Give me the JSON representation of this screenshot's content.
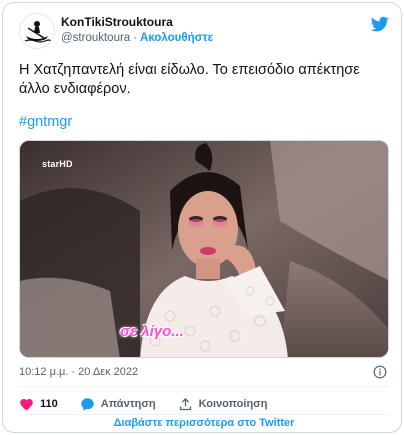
{
  "tweet": {
    "author": {
      "display_name": "KonTikiStrouktoura",
      "handle": "@strouktoura",
      "follow_label": "Ακολουθήστε"
    },
    "text": "Η Χατζηπαντελή είναι είδωλο.  Το επεισόδιο απέκτησε\nάλλο ενδιαφέρον.",
    "hashtag": "#gntmgr",
    "media": {
      "channel_logo": "starHD",
      "caption": "σε λίγο..."
    },
    "timestamp": "10:12 μ.μ. · 20 Δεκ 2022",
    "actions": {
      "likes": "110",
      "reply_label": "Απάντηση",
      "share_label": "Κοινοποίηση"
    },
    "read_more": "Διαβάστε περισσότερα στο Twitter"
  },
  "icons": {
    "brand": "twitter-bird-icon",
    "info": "info-icon",
    "like": "heart-icon",
    "reply": "speech-bubble-icon",
    "share": "share-icon"
  },
  "colors": {
    "accent": "#1d9bf0",
    "like": "#f91880",
    "secondary_text": "#536471",
    "caption": "#ff4fd8"
  }
}
